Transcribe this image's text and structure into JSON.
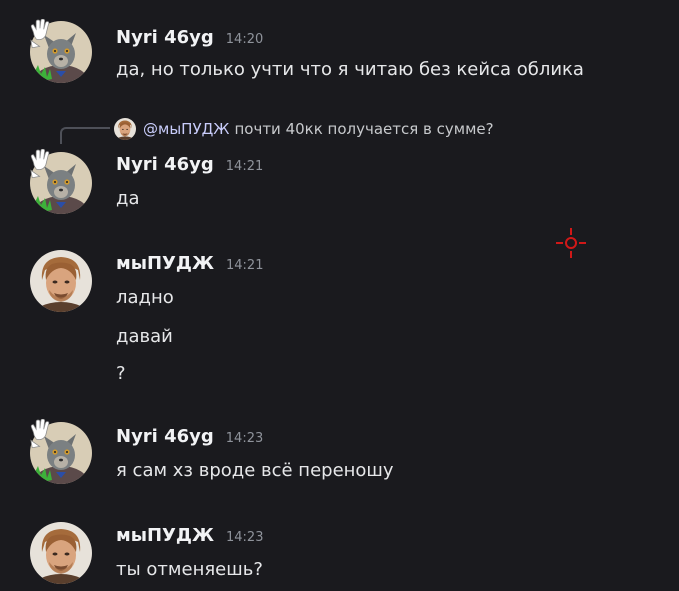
{
  "messages": [
    {
      "username": "Nyri 46yg",
      "time": "14:20",
      "avatar": "wolf-avatar",
      "lines": [
        "да, но только учти что я читаю без кейса облика"
      ]
    },
    {
      "reply": {
        "mention": "@мыПУДЖ",
        "text": "почти 40кк получается в сумме?"
      },
      "username": "Nyri 46yg",
      "time": "14:21",
      "avatar": "wolf-avatar",
      "lines": [
        "да"
      ]
    },
    {
      "username": "мыПУДЖ",
      "time": "14:21",
      "avatar": "man-avatar",
      "lines": [
        "ладно",
        "давай",
        "?"
      ]
    },
    {
      "username": "Nyri 46yg",
      "time": "14:23",
      "avatar": "wolf-avatar",
      "lines": [
        "я сам хз вроде всё переношу"
      ]
    },
    {
      "username": "мыПУДЖ",
      "time": "14:23",
      "avatar": "man-avatar",
      "lines": [
        "ты отменяешь?"
      ]
    }
  ],
  "colors": {
    "background": "#1a1a1e",
    "username": "#f2f3f5",
    "timestamp": "#8f939b",
    "crosshair": "#d01818"
  }
}
